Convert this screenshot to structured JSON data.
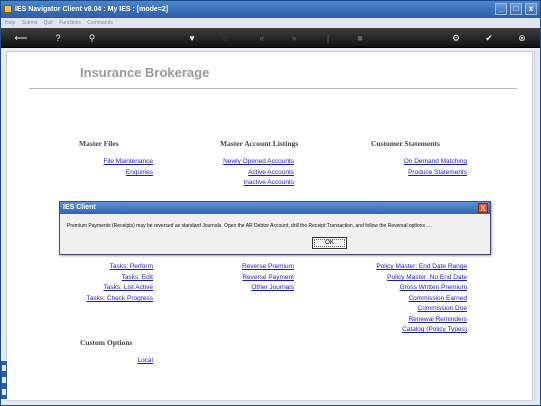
{
  "window": {
    "title": "IES Navigator Client v8.04 : My IES :       [mode=2]",
    "buttons": [
      "_",
      "□",
      "x"
    ]
  },
  "menu": [
    "Help",
    "Submit",
    "Quit",
    "Functions",
    "Commands"
  ],
  "page": {
    "title": "Insurance Brokerage"
  },
  "sections": {
    "master_files": "Master Files",
    "master_account_listings": "Master Account Listings",
    "customer_statements": "Customer Statements",
    "custom_options": "Custom Options"
  },
  "links": {
    "file_maintenance": "File Maintenance",
    "enquiries": "Enquiries",
    "newly_opened_accounts": "Newly Opened Accounts",
    "active_accounts": "Active Accounts",
    "inactive_accounts": "Inactive Accounts",
    "on_demand_matching": "On Demand Matching",
    "produce_statements": "Produce Statements",
    "tasks_perform": "Tasks: Perform",
    "tasks_edit": "Tasks: Edit",
    "tasks_list_active": "Tasks: List Active",
    "tasks_check_progress": "Tasks: Check Progress",
    "reverse_premium": "Reverse Premium",
    "reverse_payment": "Reverse Payment",
    "other_journals": "Other Journals",
    "policy_master_end_date_range": "Policy Master: End Date Range",
    "policy_master_no_end_date": "Policy Master: No End Date",
    "gross_written_premium": "Gross Written Premium",
    "commission_earned": "Commission Earned",
    "commission_due": "Commission Due",
    "renewal_reminders": "Renewal Reminders",
    "catalog_policy_types": "Catalog (Policy Types)",
    "local": "Local"
  },
  "dialog": {
    "title": "IES Client",
    "message": "Premium Payments (Receipts) may be reversed as standard Journals. Open the AR Debtor Account, drill the Receipt Transaction, and follow the Reversal options ....",
    "ok": "OK",
    "close": "X"
  }
}
